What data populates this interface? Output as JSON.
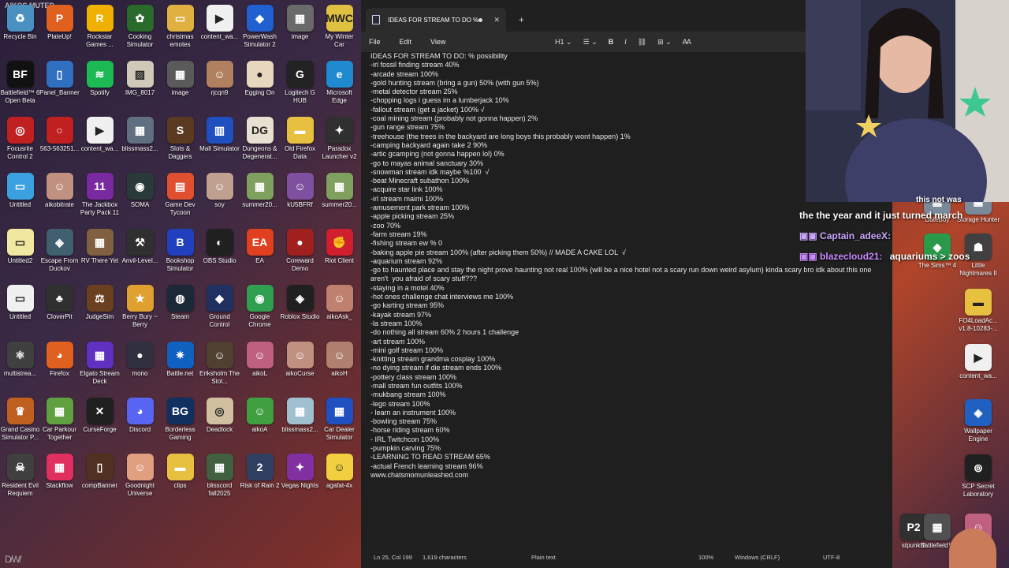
{
  "overlay": {
    "muted_text": "AIKOS MUTED"
  },
  "desktop_icons": [
    {
      "label": "Recycle Bin",
      "color": "#4a90c0",
      "glyph": "♻"
    },
    {
      "label": "PlateUp!",
      "color": "#e06020",
      "glyph": "P"
    },
    {
      "label": "Rockstar Games ...",
      "color": "#f0b000",
      "glyph": "R"
    },
    {
      "label": "Cooking Simulator",
      "color": "#2a6a2a",
      "glyph": "✿"
    },
    {
      "label": "christmas emotes",
      "color": "#e0b040",
      "glyph": "▭"
    },
    {
      "label": "content_wa...",
      "color": "#f0f0f0",
      "glyph": "▶"
    },
    {
      "label": "PowerWash Simulator 2",
      "color": "#2060d0",
      "glyph": "◆"
    },
    {
      "label": "image",
      "color": "#6a6a6a",
      "glyph": "▦"
    },
    {
      "label": "My Winter Car",
      "color": "#e0c040",
      "glyph": "MWC"
    },
    {
      "label": "Battlefield™ 6 Open Beta",
      "color": "#111111",
      "glyph": "BF"
    },
    {
      "label": "Panel_Banner",
      "color": "#3070c0",
      "glyph": "▯"
    },
    {
      "label": "Spotify",
      "color": "#1db954",
      "glyph": "≋"
    },
    {
      "label": "IMG_8017",
      "color": "#d0c8b8",
      "glyph": "▨"
    },
    {
      "label": "image",
      "color": "#5a5a5a",
      "glyph": "▦"
    },
    {
      "label": "rjcqn9",
      "color": "#b08060",
      "glyph": "☺"
    },
    {
      "label": "Egging On",
      "color": "#e8d8c0",
      "glyph": "●"
    },
    {
      "label": "Logitech G HUB",
      "color": "#222222",
      "glyph": "G"
    },
    {
      "label": "Microsoft Edge",
      "color": "#1f8ad0",
      "glyph": "e"
    },
    {
      "label": "Focusrite Control 2",
      "color": "#c02020",
      "glyph": "◎"
    },
    {
      "label": "563-563251...",
      "color": "#c02020",
      "glyph": "○"
    },
    {
      "label": "content_wa...",
      "color": "#f0f0f0",
      "glyph": "▶"
    },
    {
      "label": "blissmass2...",
      "color": "#607080",
      "glyph": "▦"
    },
    {
      "label": "Slots & Daggers",
      "color": "#5a3a20",
      "glyph": "S"
    },
    {
      "label": "Mall Simulator",
      "color": "#2050c0",
      "glyph": "▥"
    },
    {
      "label": "Dungeons & Degenerat...",
      "color": "#e8e0d0",
      "glyph": "DG"
    },
    {
      "label": "Old Firefox Data",
      "color": "#e8c040",
      "glyph": "▬"
    },
    {
      "label": "Paradox Launcher v2",
      "color": "#303030",
      "glyph": "✦"
    },
    {
      "label": "Untitled",
      "color": "#3aa0e0",
      "glyph": "▭"
    },
    {
      "label": "aikobitrate",
      "color": "#c09080",
      "glyph": "☺"
    },
    {
      "label": "The Jackbox Party Pack 11",
      "color": "#7a2aa0",
      "glyph": "11"
    },
    {
      "label": "SOMA",
      "color": "#2a3a3a",
      "glyph": "◉"
    },
    {
      "label": "Game Dev Tycoon",
      "color": "#e05030",
      "glyph": "▤"
    },
    {
      "label": "soy",
      "color": "#c0a090",
      "glyph": "☺"
    },
    {
      "label": "summer20...",
      "color": "#80a060",
      "glyph": "▦"
    },
    {
      "label": "kU5BFRf",
      "color": "#8050a0",
      "glyph": "☺"
    },
    {
      "label": "summer20...",
      "color": "#80a060",
      "glyph": "▦"
    },
    {
      "label": "Untitled2",
      "color": "#f0e8a0",
      "glyph": "▭"
    },
    {
      "label": "Escape From Duckov",
      "color": "#406070",
      "glyph": "◈"
    },
    {
      "label": "RV There Yet",
      "color": "#806040",
      "glyph": "▦"
    },
    {
      "label": "Anvil-Level...",
      "color": "#303030",
      "glyph": "⚒"
    },
    {
      "label": "Bookshop Simulator",
      "color": "#2040c0",
      "glyph": "B"
    },
    {
      "label": "OBS Studio",
      "color": "#202020",
      "glyph": "◐"
    },
    {
      "label": "EA",
      "color": "#e04020",
      "glyph": "EA"
    },
    {
      "label": "Coreward Demo",
      "color": "#a02020",
      "glyph": "●"
    },
    {
      "label": "Riot Client",
      "color": "#d02030",
      "glyph": "✊"
    },
    {
      "label": "Untitled",
      "color": "#f0f0f0",
      "glyph": "▭"
    },
    {
      "label": "CloverPit",
      "color": "#303030",
      "glyph": "♣"
    },
    {
      "label": "JudgeSim",
      "color": "#6a4020",
      "glyph": "⚖"
    },
    {
      "label": "Berry Bury ~ Berry",
      "color": "#e0a030",
      "glyph": "★"
    },
    {
      "label": "Steam",
      "color": "#1b2838",
      "glyph": "◍"
    },
    {
      "label": "Ground Control",
      "color": "#203060",
      "glyph": "◆"
    },
    {
      "label": "Google Chrome",
      "color": "#30a050",
      "glyph": "◉"
    },
    {
      "label": "Roblox Studio",
      "color": "#202020",
      "glyph": "◈"
    },
    {
      "label": "aikoAsk_",
      "color": "#c08070",
      "glyph": "☺"
    },
    {
      "label": "multistrea...",
      "color": "#404040",
      "glyph": "⚛"
    },
    {
      "label": "Firefox",
      "color": "#e06020",
      "glyph": "◕"
    },
    {
      "label": "Elgato Stream Deck",
      "color": "#6030c0",
      "glyph": "▦"
    },
    {
      "label": "mono",
      "color": "#303040",
      "glyph": "●"
    },
    {
      "label": "Battle.net",
      "color": "#1060c0",
      "glyph": "✷"
    },
    {
      "label": "Eriksholm The Stol...",
      "color": "#504030",
      "glyph": "☺"
    },
    {
      "label": "aikoL",
      "color": "#c06080",
      "glyph": "☺"
    },
    {
      "label": "aikoCurse",
      "color": "#c09080",
      "glyph": "☺"
    },
    {
      "label": "aikoH",
      "color": "#b08070",
      "glyph": "☺"
    },
    {
      "label": "Grand Casino Simulator P...",
      "color": "#c06020",
      "glyph": "♛"
    },
    {
      "label": "Car Parkour Together",
      "color": "#60a040",
      "glyph": "▦"
    },
    {
      "label": "CurseForge",
      "color": "#202020",
      "glyph": "✕"
    },
    {
      "label": "Discord",
      "color": "#5865f2",
      "glyph": "◕"
    },
    {
      "label": "Borderless Gaming",
      "color": "#103060",
      "glyph": "BG"
    },
    {
      "label": "Deadlock",
      "color": "#d0c0a0",
      "glyph": "◎"
    },
    {
      "label": "aikoA",
      "color": "#40a040",
      "glyph": "☺"
    },
    {
      "label": "blissmass2...",
      "color": "#a0c0d0",
      "glyph": "▦"
    },
    {
      "label": "Car Dealer Simulator",
      "color": "#2050c0",
      "glyph": "▦"
    },
    {
      "label": "Resident Evil Requiem",
      "color": "#404040",
      "glyph": "☠"
    },
    {
      "label": "Stackflow",
      "color": "#e03060",
      "glyph": "▦"
    },
    {
      "label": "compBanner",
      "color": "#503020",
      "glyph": "▯"
    },
    {
      "label": "Goodnight Universe",
      "color": "#e0a080",
      "glyph": "☺"
    },
    {
      "label": "clips",
      "color": "#e8c040",
      "glyph": "▬"
    },
    {
      "label": "bliss​cord fall2025",
      "color": "#406040",
      "glyph": "▦"
    },
    {
      "label": "Risk of Rain 2",
      "color": "#304060",
      "glyph": "2"
    },
    {
      "label": "Vegas Nights",
      "color": "#8030a0",
      "glyph": "✦"
    },
    {
      "label": "agafat-4x",
      "color": "#f0d040",
      "glyph": "☺"
    }
  ],
  "right_icons": [
    {
      "label": "DateBoy",
      "color": "#7a8a9a",
      "glyph": "▦"
    },
    {
      "label": "Storage Hunter",
      "color": "#7a8a9a",
      "glyph": "▦"
    },
    {
      "label": "The Sims™ 4",
      "color": "#2a9a4a",
      "glyph": "◆"
    },
    {
      "label": "Little Nightmares II",
      "color": "#404040",
      "glyph": "☗"
    },
    {
      "label": "FO4LoadAc... v1.8-10283-...",
      "color": "#e8c040",
      "glyph": "▬"
    },
    {
      "label": "content_wa...",
      "color": "#f0f0f0",
      "glyph": "▶"
    },
    {
      "label": "Wallpaper Engine",
      "color": "#2060c0",
      "glyph": "◈"
    },
    {
      "label": "SCP Secret Laboratory",
      "color": "#202020",
      "glyph": "⊚"
    },
    {
      "label": "stpunk 2",
      "color": "#303030",
      "glyph": "P2"
    },
    {
      "label": "Battlefield™",
      "color": "#505050",
      "glyph": "▦"
    },
    {
      "label": "Little",
      "color": "#c06080",
      "glyph": "☺"
    }
  ],
  "notepad": {
    "tab_title": "IDEAS FOR STREAM TO DO % possi",
    "menu": [
      "File",
      "Edit",
      "View"
    ],
    "toolbar": {
      "heading": "H1",
      "bold": "B",
      "italic": "I"
    },
    "lines": [
      "IDEAS FOR STREAM TO DO: % possibility",
      "-irl fossil finding stream 40%",
      "-arcade stream 100%",
      "-gold hunting stream (bring a gun) 50% (with gun 5%)",
      "-metal detector stream 25%",
      "-chopping logs i guess im a lumberjack 10%",
      "-fallout stream (get a jacket) 100% √",
      "-coal mining stream (probably not gonna happen) 2%",
      "-gun range stream 75%",
      "-treehouse (the trees in the backyard are long boys this probably wont happen) 1%",
      "-camping backyard again take 2 90%",
      "-artic gcamping (not gonna happen lol) 0%",
      "-go to mayas animal sanctuary 30%",
      "-snowman stream idk maybe %100  √",
      "-beat Minecraft subathon 100%",
      "-acquire star link 100%",
      "-irl stream maimi 100%",
      "-amusement park stream 100%",
      "-apple picking stream 25%",
      "-zoo 70%",
      "-farm stream 19%",
      "-fishing stream ew % 0",
      "-baking apple pie stream 100% (after picking them 50%) // MADE A CAKE LOL  √",
      "-aquarium stream 92%",
      "-go to haunted place and stay the night prove haunting not real 100% (will be a nice hotel not a scary run down weird asylum) kinda scary bro idk about this one aren't  you afraid of scary stuff???",
      "-staying in a motel 40%",
      "-hot ones challenge chat interviews me 100%",
      "-go karting stream 95%",
      "-kayak stream 97%",
      "-la stream 100%",
      "-do nothing all stream 60% 2 hours 1 challenge",
      "-art stream 100%",
      "-mini golf stream 100%",
      "-knitting stream grandma cosplay 100%",
      "-no dying stream if die stream ends 100%",
      "-pottery class stream 100%",
      "-mall stream fun outfits 100%",
      "-mukbang stream 100%",
      "-lego stream 100%",
      "- learn an instrument 100%",
      "-bowling stream 75%",
      "-horse riding stream 60%",
      "- IRL Twitchcon 100%",
      "-pumpkin carving 75%",
      "-LEARNING TO READ STREAM 65%",
      "-actual French learning stream 96%",
      "www.chatsmomunleashed.com"
    ],
    "status": {
      "position": "Ln 25, Col 199",
      "characters": "1,619 characters",
      "format": "Plain text",
      "zoom": "100%",
      "line_ending": "Windows (CRLF)",
      "encoding": "UTF-8"
    }
  },
  "chat": [
    {
      "user": "",
      "text": "the the year and it just turned march"
    },
    {
      "user": "Captain_adeeX:",
      "text": "",
      "color": "#c9a6ff"
    },
    {
      "user": "blazecloud21:",
      "text": "aquariums > zoos",
      "color": "#c98aff"
    }
  ],
  "chat_partial_top": "this not was"
}
